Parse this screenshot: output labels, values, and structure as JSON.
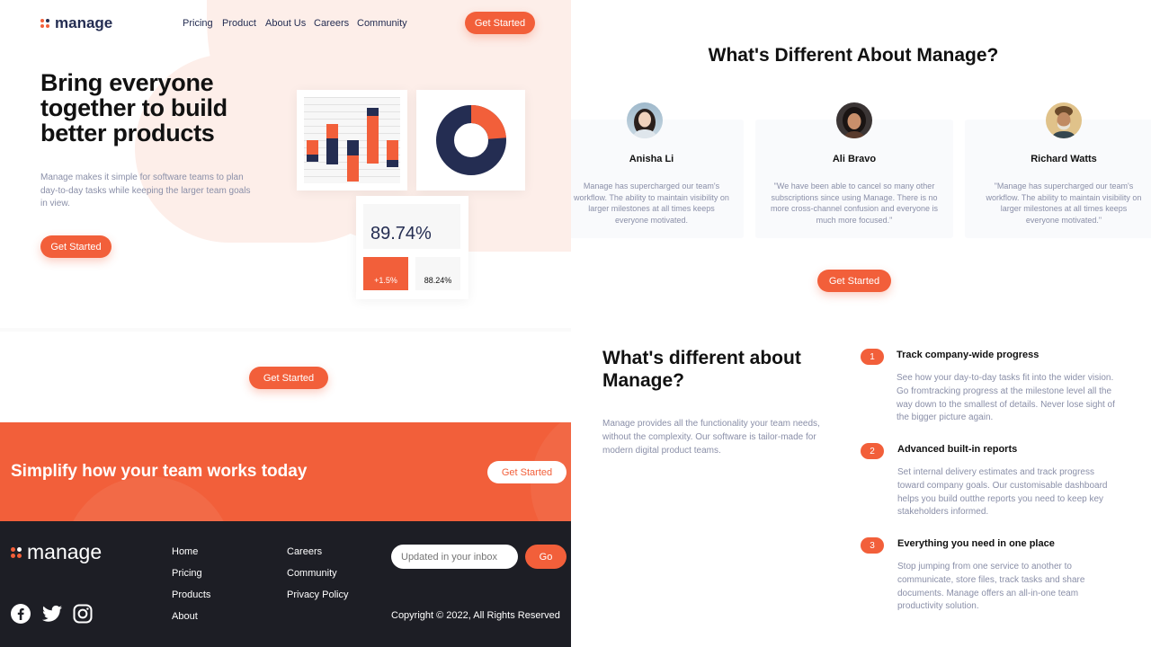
{
  "header": {
    "logo_text": "manage",
    "nav": [
      "Pricing",
      "Product",
      "About Us",
      "Careers",
      "Community"
    ],
    "cta": "Get Started"
  },
  "hero": {
    "title": "Bring everyone together to build better products",
    "subtitle": "Manage makes it simple for software teams to plan day-to-day tasks while keeping the larger team goals in view.",
    "cta": "Get Started",
    "stat_main": "89.74%",
    "stat_delta": "+1.5%",
    "stat_secondary": "88.24%"
  },
  "mid_cta": "Get Started",
  "band": {
    "title": "Simplify how your team works today",
    "cta": "Get Started"
  },
  "footer": {
    "logo_text": "manage",
    "links_col1": [
      "Home",
      "Pricing",
      "Products",
      "About"
    ],
    "links_col2": [
      "Careers",
      "Community",
      "Privacy Policy"
    ],
    "newsletter_placeholder": "Updated in your inbox",
    "go": "Go",
    "copyright": "Copyright © 2022, All Rights Reserved",
    "social_icons": [
      "facebook-icon",
      "twitter-icon",
      "instagram-icon"
    ]
  },
  "testimonials": {
    "heading": "What's Different About Manage?",
    "items": [
      {
        "name": "Anisha Li",
        "quote": "Manage has supercharged our team's workflow. The ability to maintain visibility on larger milestones at all times keeps everyone motivated."
      },
      {
        "name": "Ali Bravo",
        "quote": "\"We have been able to cancel so many other subscriptions since using Manage. There is no more cross-channel confusion and everyone is much more focused.\""
      },
      {
        "name": "Richard Watts",
        "quote": "\"Manage has supercharged our team's workflow. The ability to maintain visibility on larger milestones at all times keeps everyone motivated.\""
      }
    ],
    "cta": "Get Started"
  },
  "features": {
    "heading": "What's different about Manage?",
    "intro": "Manage provides all the functionality your team needs, without the complexity. Our software is tailor-made for modern digital product teams.",
    "items": [
      {
        "num": "1",
        "title": "Track company-wide progress",
        "body": "See how your day-to-day tasks fit into the wider vision. Go fromtracking progress at the milestone level all the way down to the smallest of details. Never lose sight of the bigger picture again."
      },
      {
        "num": "2",
        "title": "Advanced built-in reports",
        "body": "Set internal delivery estimates and track progress toward company goals. Our customisable dashboard helps you build outthe reports you need to keep key stakeholders informed."
      },
      {
        "num": "3",
        "title": "Everything you need in one place",
        "body": "Stop jumping from one service to another to communicate, store files, track tasks and share documents. Manage offers an all-in-one team productivity solution."
      }
    ]
  },
  "colors": {
    "accent": "#f25f3a",
    "navy": "#242d52",
    "footer_bg": "#1d1e25"
  }
}
